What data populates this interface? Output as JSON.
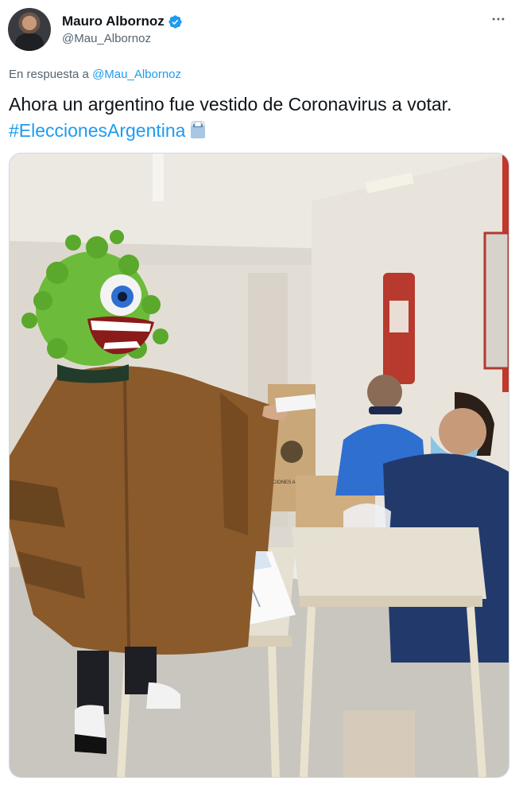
{
  "author": {
    "display_name": "Mauro Albornoz",
    "handle": "@Mau_Albornoz",
    "verified": true,
    "avatar_icon": "profile-photo"
  },
  "reply": {
    "prefix": "En respuesta a",
    "mention": "@Mau_Albornoz"
  },
  "tweet": {
    "text": "Ahora un argentino fue vestido de Coronavirus a votar.",
    "hashtag": "#EleccionesArgentina",
    "emoji": "ballot-box-icon"
  },
  "media": {
    "description_icon": "photo",
    "box_label": "ELECCIONES ARGENTINAS"
  },
  "colors": {
    "accent": "#1d9bf0",
    "text": "#0f1419",
    "secondary": "#536471"
  }
}
